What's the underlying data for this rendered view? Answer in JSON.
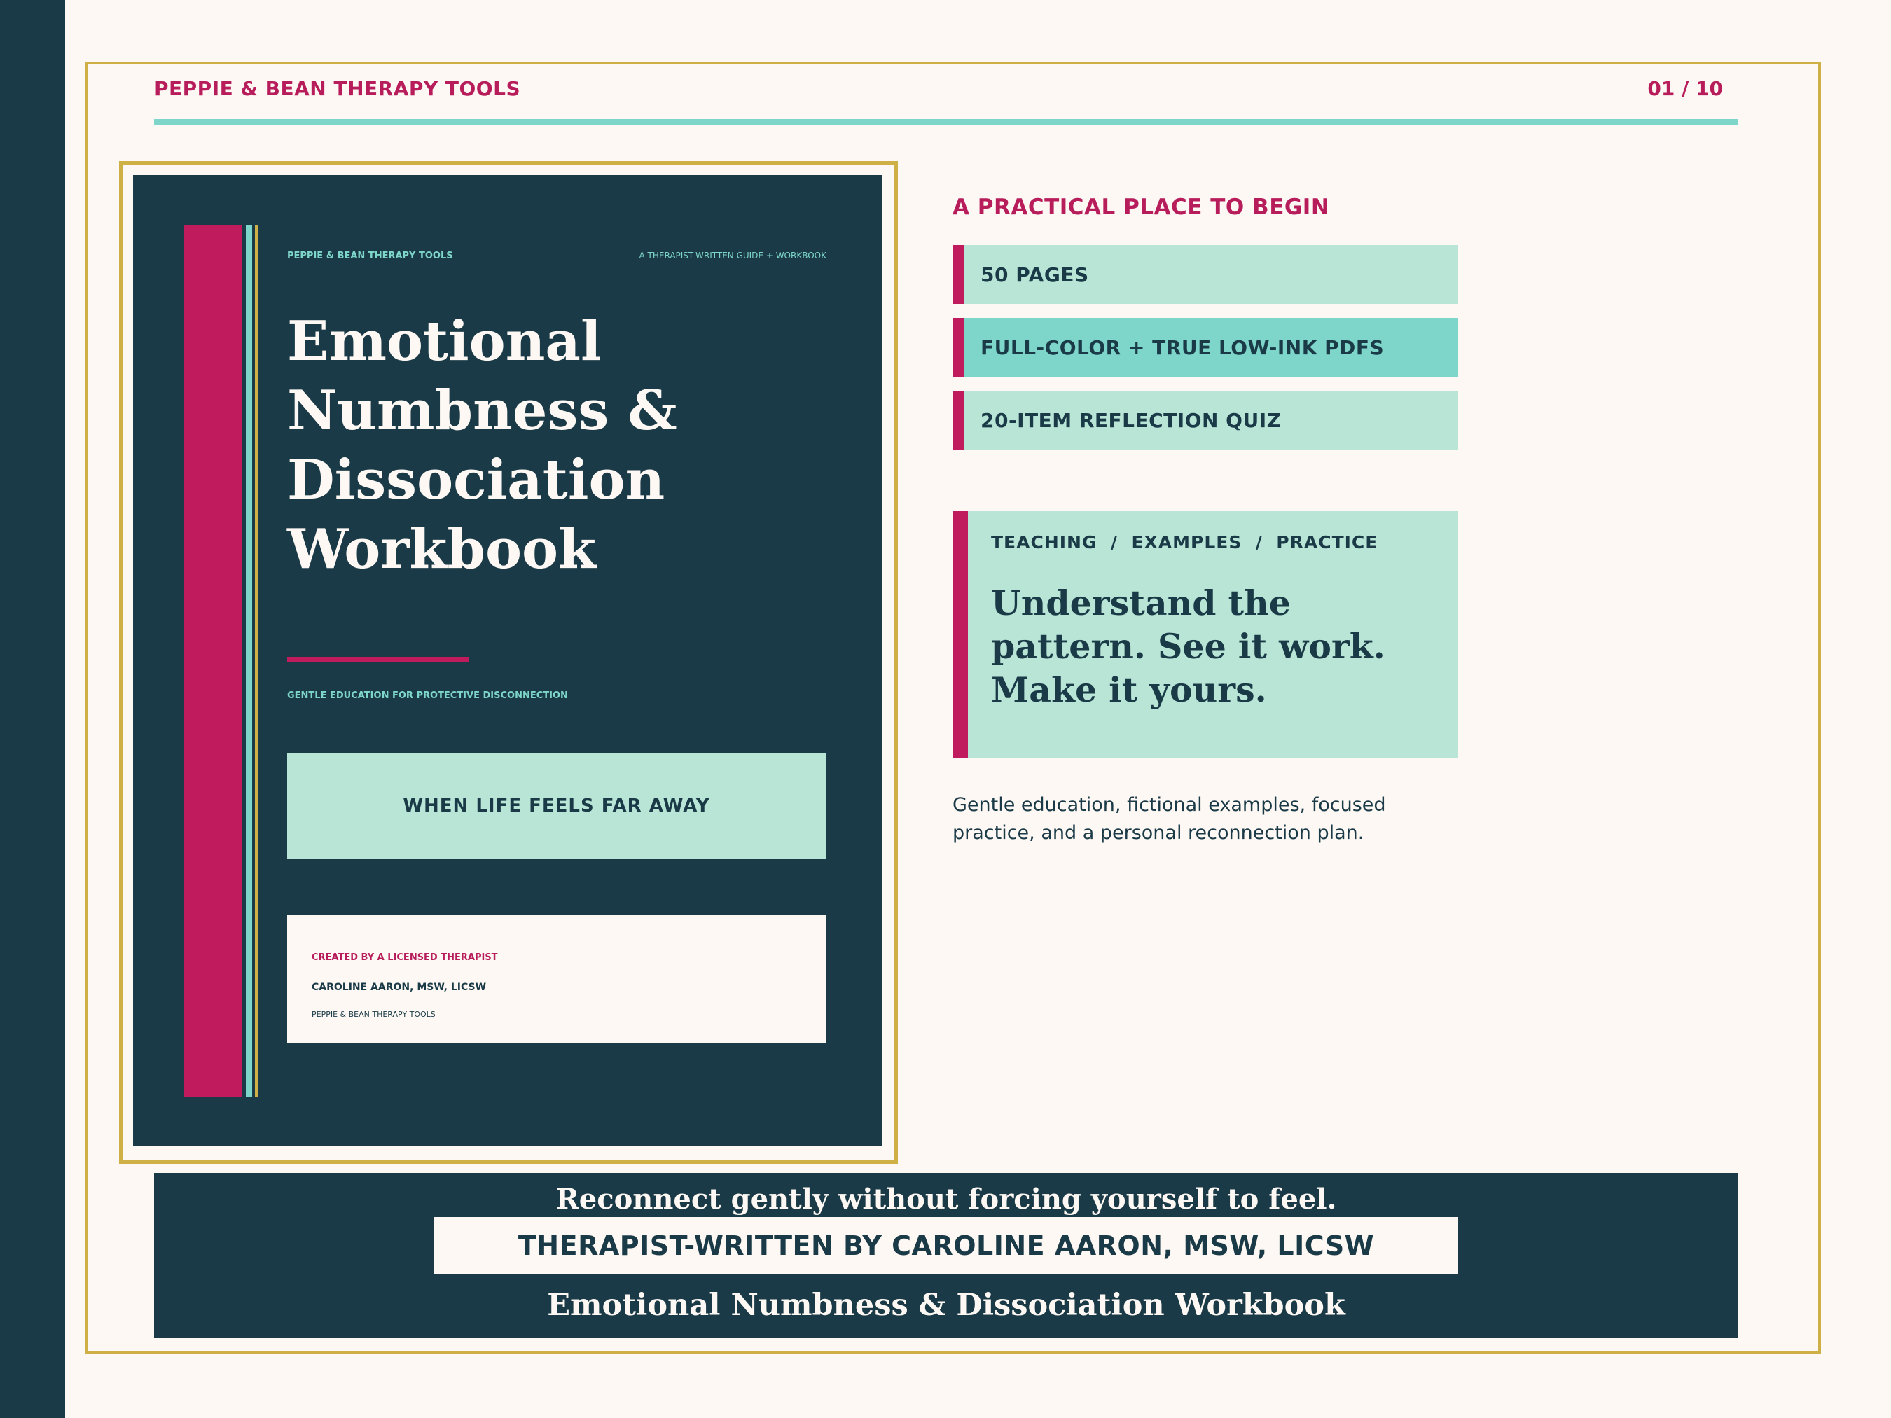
{
  "header": {
    "brand": "PEPPIE & BEAN THERAPY TOOLS",
    "page_indicator": "01 / 10"
  },
  "cover": {
    "brand": "PEPPIE & BEAN THERAPY TOOLS",
    "tagline": "A THERAPIST-WRITTEN GUIDE + WORKBOOK",
    "title_lines": [
      "Emotional",
      "Numbness &",
      "Dissociation",
      "Workbook"
    ],
    "subtitle": "GENTLE EDUCATION FOR PROTECTIVE DISCONNECTION",
    "band_text": "WHEN LIFE FEELS FAR AWAY",
    "credit": {
      "label": "CREATED BY A LICENSED THERAPIST",
      "name": "CAROLINE AARON, MSW, LICSW",
      "brand": "PEPPIE & BEAN THERAPY TOOLS"
    }
  },
  "details": {
    "heading": "A PRACTICAL PLACE TO BEGIN",
    "features": [
      "50 PAGES",
      "FULL-COLOR + TRUE LOW-INK PDFS",
      "20-ITEM REFLECTION QUIZ"
    ],
    "quote_card": {
      "kicker": "TEACHING  /  EXAMPLES  /  PRACTICE",
      "body": "Understand the pattern. See it work. Make it yours."
    },
    "description": "Gentle education, fictional examples, focused practice, and a personal reconnection plan."
  },
  "footer": {
    "tagline": "Reconnect gently without forcing yourself to feel.",
    "credit": "THERAPIST-WRITTEN BY CAROLINE AARON, MSW, LICSW",
    "title": "Emotional Numbness & Dissociation Workbook"
  },
  "colors": {
    "navy": "#1a3a47",
    "magenta": "#c01b5c",
    "teal": "#7ed6ca",
    "mint": "#b8e5d6",
    "gold": "#cfb046",
    "cream": "#fdf8f3"
  }
}
